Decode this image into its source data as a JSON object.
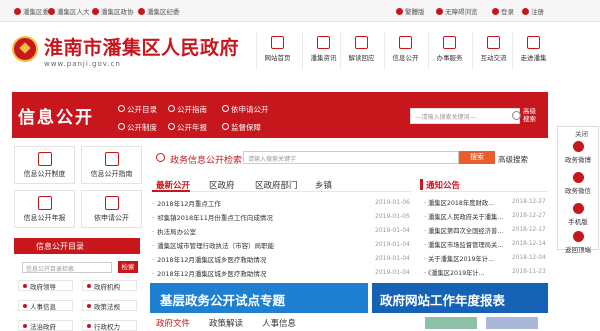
{
  "topbar": {
    "links": [
      "潘集区委",
      "潘集区人大",
      "潘集区政协",
      "潘集区纪委"
    ],
    "right": [
      "繁體版",
      "无障碍浏览",
      "登录",
      "注册"
    ]
  },
  "header": {
    "title": "淮南市潘集区人民政府",
    "url": "www.panji.gov.cn",
    "nav": [
      "网站首页",
      "潘集资讯",
      "解读回应",
      "信息公开",
      "办事服务",
      "互动交流",
      "走进潘集"
    ]
  },
  "banner": {
    "title": "信息公开",
    "links": [
      "公开目录",
      "公开指南",
      "依申请公开",
      "公开制度",
      "公开年报",
      "监督保障"
    ],
    "search_placeholder": "---请输入搜索关键词---",
    "advanced": "高级搜索"
  },
  "quick": [
    "信息公开制度",
    "信息公开指南",
    "信息公开年报",
    "依申请公开"
  ],
  "catalog": {
    "title": "信息公开目录",
    "search_placeholder": "信息公开目录检索",
    "search_button": "检索",
    "items": [
      "政府领导",
      "政府机构",
      "人事信息",
      "政策法规",
      "法治政府",
      "行政权力"
    ]
  },
  "public_search": {
    "label": "政务信息公开检索",
    "placeholder": "请输入搜索关键字",
    "button": "搜索",
    "advanced": "高级搜索"
  },
  "tabs": [
    "最新公开",
    "区政府",
    "区政府部门",
    "乡镇"
  ],
  "news": [
    {
      "title": "2018年12月重点工作",
      "date": "2019-01-06"
    },
    {
      "title": "祁集镇2018年11月份重点工作向成情况",
      "date": "2019-01-05"
    },
    {
      "title": "执法局办公室",
      "date": "2019-01-04"
    },
    {
      "title": "潘集区城市管理行政执法（市容）局职能",
      "date": "2019-01-04"
    },
    {
      "title": "2018年12月潘集区城乡医疗救助情况",
      "date": "2019-01-04"
    },
    {
      "title": "2018年12月潘集区城乡医疗救助情况",
      "date": "2019-01-04"
    }
  ],
  "notice": {
    "title": "通知公告",
    "items": [
      {
        "title": "潘集区2018年度财政...",
        "date": "2018-12-27"
      },
      {
        "title": "潘集区人民政府关于潘集...",
        "date": "2018-12-27"
      },
      {
        "title": "潘集区第四次全国经济普...",
        "date": "2018-12-17"
      },
      {
        "title": "潘集区市场监督管理局关...",
        "date": "2018-12-14"
      },
      {
        "title": "关于潘集区2019年计...",
        "date": "2018-12-04"
      },
      {
        "title": "《潘集区2019年计...",
        "date": "2018-11-23"
      }
    ]
  },
  "banners": [
    "基层政务公开试点专题",
    "政府网站工作年度报表"
  ],
  "bottom_tabs": [
    "政府文件",
    "政策解读",
    "人事信息"
  ],
  "float": {
    "close": "关闭",
    "items": [
      "政务微博",
      "政务微信",
      "手机版",
      "返回顶端"
    ]
  }
}
